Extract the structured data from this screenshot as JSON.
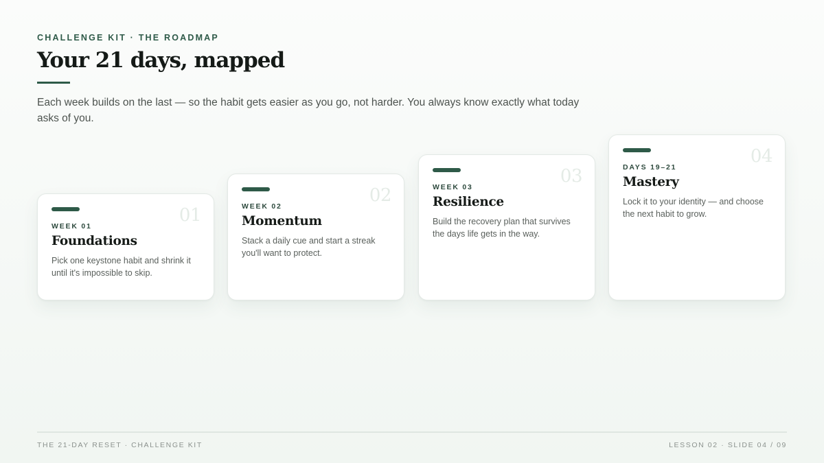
{
  "header": {
    "eyebrow": "CHALLENGE KIT · THE ROADMAP",
    "title": "Your 21 days, mapped",
    "intro": "Each week builds on the last — so the habit gets easier as you go, not harder. You always know exactly what today asks of you."
  },
  "cards": [
    {
      "number": "01",
      "label": "WEEK 01",
      "title": "Foundations",
      "description": "Pick one keystone habit and shrink it until it's impossible to skip."
    },
    {
      "number": "02",
      "label": "WEEK 02",
      "title": "Momentum",
      "description": "Stack a daily cue and start a streak you'll want to protect."
    },
    {
      "number": "03",
      "label": "WEEK 03",
      "title": "Resilience",
      "description": "Build the recovery plan that survives the days life gets in the way."
    },
    {
      "number": "04",
      "label": "DAYS 19–21",
      "title": "Mastery",
      "description": "Lock it to your identity — and choose the next habit to grow."
    }
  ],
  "footer": {
    "left": "THE 21-DAY RESET · CHALLENGE KIT",
    "right": "LESSON 02 · SLIDE 04 / 09"
  },
  "colors": {
    "accent": "#2e5a48",
    "title": "#151a17",
    "background": "#f4f8f5"
  }
}
